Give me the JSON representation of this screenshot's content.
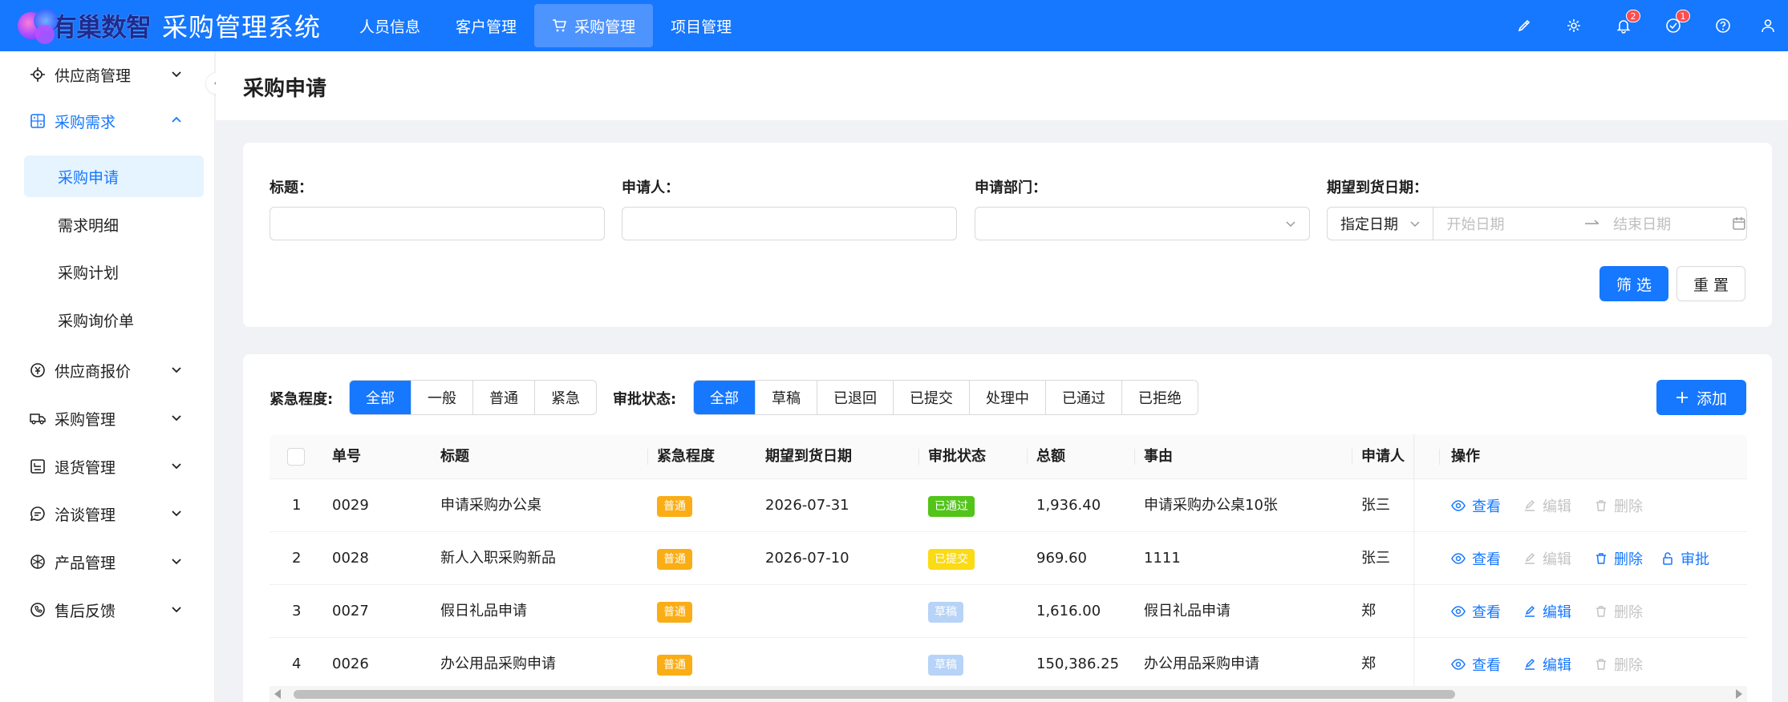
{
  "header": {
    "brand": "有巢数智",
    "title": "采购管理系统",
    "nav": [
      {
        "label": "人员信息"
      },
      {
        "label": "客户管理"
      },
      {
        "label": "采购管理"
      },
      {
        "label": "项目管理"
      }
    ],
    "badges": {
      "notifications": "2",
      "tasks": "1"
    }
  },
  "sidebar": {
    "items": [
      {
        "label": "供应商管理"
      },
      {
        "label": "采购需求"
      },
      {
        "label": "供应商报价"
      },
      {
        "label": "采购管理"
      },
      {
        "label": "退货管理"
      },
      {
        "label": "洽谈管理"
      },
      {
        "label": "产品管理"
      },
      {
        "label": "售后反馈"
      }
    ],
    "sub_items": [
      {
        "label": "采购申请"
      },
      {
        "label": "需求明细"
      },
      {
        "label": "采购计划"
      },
      {
        "label": "采购询价单"
      }
    ]
  },
  "page": {
    "title": "采购申请"
  },
  "filters": {
    "title_label": "标题：",
    "applicant_label": "申请人：",
    "dept_label": "申请部门：",
    "date_label": "期望到货日期：",
    "date_type": "指定日期",
    "start_placeholder": "开始日期",
    "end_placeholder": "结束日期",
    "filter_button": "筛 选",
    "reset_button": "重 置"
  },
  "toolbar": {
    "urgency_label": "紧急程度:",
    "urgency_options": [
      "全部",
      "一般",
      "普通",
      "紧急"
    ],
    "status_label": "审批状态:",
    "status_options": [
      "全部",
      "草稿",
      "已退回",
      "已提交",
      "处理中",
      "已通过",
      "已拒绝"
    ],
    "add_button": "添加"
  },
  "table": {
    "columns": [
      "单号",
      "标题",
      "紧急程度",
      "期望到货日期",
      "审批状态",
      "总额",
      "事由",
      "申请人",
      "操作"
    ],
    "rows": [
      {
        "index": "1",
        "no": "0029",
        "title": "申请采购办公桌",
        "urgency": "普通",
        "date": "2026-07-31",
        "status": "已通过",
        "amount": "1,936.40",
        "reason": "申请采购办公桌10张",
        "applicant": "张三"
      },
      {
        "index": "2",
        "no": "0028",
        "title": "新人入职采购新品",
        "urgency": "普通",
        "date": "2026-07-10",
        "status": "已提交",
        "amount": "969.60",
        "reason": "1111",
        "applicant": "张三"
      },
      {
        "index": "3",
        "no": "0027",
        "title": "假日礼品申请",
        "urgency": "普通",
        "date": "",
        "status": "草稿",
        "amount": "1,616.00",
        "reason": "假日礼品申请",
        "applicant": "郑"
      },
      {
        "index": "4",
        "no": "0026",
        "title": "办公用品采购申请",
        "urgency": "普通",
        "date": "",
        "status": "草稿",
        "amount": "150,386.25",
        "reason": "办公用品采购申请",
        "applicant": "郑"
      }
    ],
    "actions": {
      "view": "查看",
      "edit": "编辑",
      "delete": "删除",
      "approve": "审批"
    }
  },
  "colors": {
    "primary": "#1677ff",
    "tag_normal": "#faad14",
    "status_passed": "#52c41a",
    "status_submitted": "#fadb14",
    "status_draft": "#b7d3f7"
  }
}
